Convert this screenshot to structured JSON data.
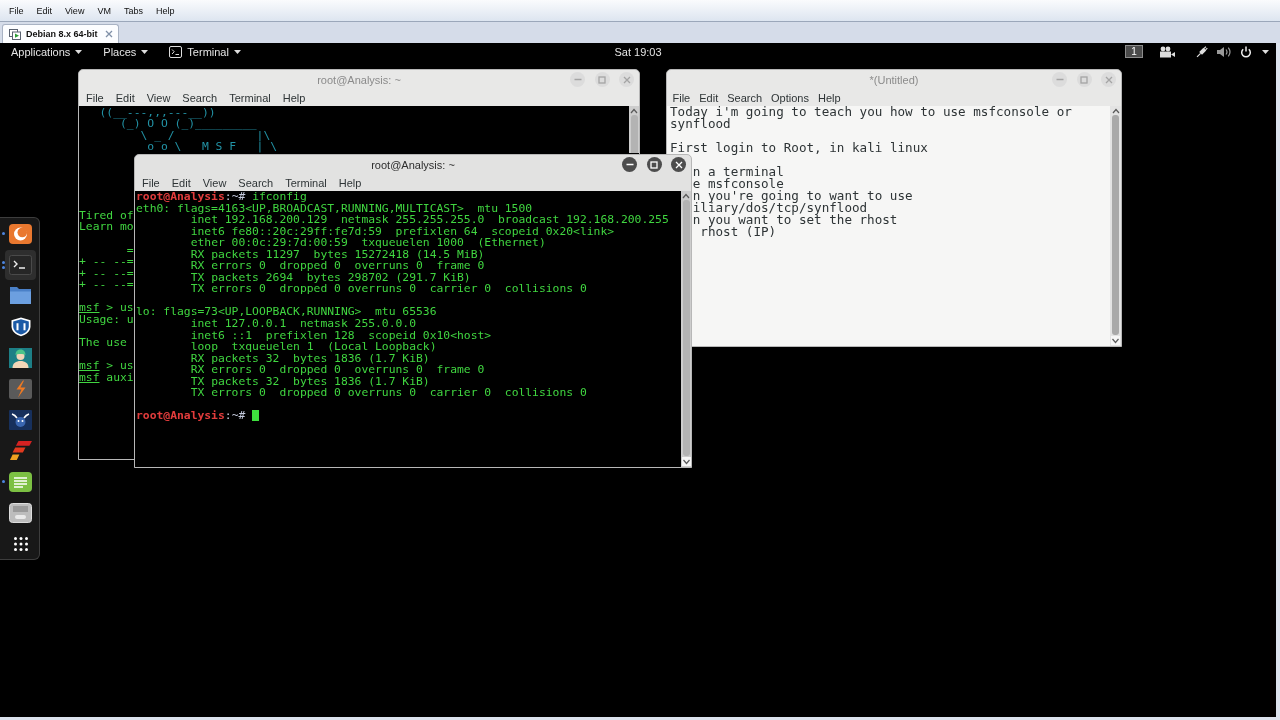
{
  "menu_bar": {
    "items": [
      "File",
      "Edit",
      "View",
      "VM",
      "Tabs",
      "Help"
    ]
  },
  "tabs": [
    {
      "label": "Debian 8.x 64-bit",
      "selected": true
    }
  ],
  "top_bar": {
    "menus": [
      {
        "label": "Applications",
        "kind": "menu"
      },
      {
        "label": "Places",
        "kind": "menu"
      },
      {
        "label": "Terminal",
        "kind": "app-menu"
      }
    ],
    "clock": "Sat 19:03",
    "workspace": "1"
  },
  "dock": [
    {
      "kind": "browser",
      "selected": false,
      "running": true,
      "multiple_windows": false
    },
    {
      "kind": "terminal",
      "selected": true,
      "running": true,
      "multiple_windows": true
    },
    {
      "kind": "files",
      "selected": false,
      "running": false,
      "multiple_windows": false
    },
    {
      "kind": "shield",
      "selected": false,
      "running": false,
      "multiple_windows": false
    },
    {
      "kind": "avatar",
      "selected": false,
      "running": false,
      "multiple_windows": false
    },
    {
      "kind": "lightning",
      "selected": false,
      "running": false,
      "multiple_windows": false
    },
    {
      "kind": "horned-head",
      "selected": false,
      "running": false,
      "multiple_windows": false
    },
    {
      "kind": "slanted-bars",
      "selected": false,
      "running": false,
      "multiple_windows": false
    },
    {
      "kind": "notepad",
      "selected": false,
      "running": true,
      "multiple_windows": false
    },
    {
      "kind": "keypad",
      "selected": false,
      "running": false,
      "multiple_windows": false
    },
    {
      "kind": "app-grid",
      "selected": false,
      "running": false,
      "multiple_windows": false
    }
  ],
  "windows": [
    {
      "kind": "terminal",
      "title": "root@Analysis: ~",
      "active": false,
      "menu": [
        "File",
        "Edit",
        "View",
        "Search",
        "Terminal",
        "Help"
      ],
      "banner": [
        "   ((__---,,,---__))",
        "      (_) O O (_)_________",
        "         \\ _ /            |\\",
        "          o o \\   M S F   | \\"
      ],
      "blocks": [
        {
          "lines": [
            {
              "kind": "output",
              "text": "Tired of"
            },
            {
              "kind": "output",
              "text": "Learn mo"
            }
          ]
        },
        {
          "lines": [
            {
              "kind": "output",
              "text": "       ="
            },
            {
              "kind": "output",
              "text": "+ -- --="
            },
            {
              "kind": "output",
              "text": "+ -- --="
            },
            {
              "kind": "output",
              "text": "+ -- --="
            }
          ]
        },
        {
          "lines": [
            {
              "kind": "msf",
              "prompt": "msf",
              "text": " > us"
            },
            {
              "kind": "output",
              "text": "Usage: u"
            }
          ]
        },
        {
          "lines": [
            {
              "kind": "output",
              "text": "The use"
            }
          ]
        },
        {
          "lines": [
            {
              "kind": "msf",
              "prompt": "msf",
              "text": " > us"
            },
            {
              "kind": "msf",
              "prompt": "msf",
              "text": " auxi"
            }
          ]
        }
      ]
    },
    {
      "kind": "editor",
      "title": "*(Untitled)",
      "active": false,
      "menu": [
        "File",
        "Edit",
        "Search",
        "Options",
        "Help"
      ],
      "paragraphs": [
        {
          "covered": false,
          "lines": [
            "Today i'm going to teach you how to use msfconsole or synflood"
          ]
        },
        {
          "covered": false,
          "lines": [
            "First login to Root, in kali linux"
          ]
        },
        {
          "covered": true,
          "lines": [
            "n a terminal",
            "e msfconsole",
            "n you're going to want to use",
            "iliary/dos/tcp/synflood",
            "n you want to set the rhost",
            " rhost (IP)"
          ]
        }
      ]
    },
    {
      "kind": "terminal",
      "title": "root@Analysis: ~",
      "active": true,
      "menu": [
        "File",
        "Edit",
        "View",
        "Search",
        "Terminal",
        "Help"
      ],
      "blocks": [
        {
          "lines": [
            {
              "kind": "prompt",
              "user": "root@Analysis",
              "path": ":~#",
              "command": "ifconfig"
            },
            {
              "kind": "output",
              "text": "eth0: flags=4163<UP,BROADCAST,RUNNING,MULTICAST>  mtu 1500"
            },
            {
              "kind": "output",
              "text": "        inet 192.168.200.129  netmask 255.255.255.0  broadcast 192.168.200.255"
            },
            {
              "kind": "output",
              "text": "        inet6 fe80::20c:29ff:fe7d:59  prefixlen 64  scopeid 0x20<link>"
            },
            {
              "kind": "output",
              "text": "        ether 00:0c:29:7d:00:59  txqueuelen 1000  (Ethernet)"
            },
            {
              "kind": "output",
              "text": "        RX packets 11297  bytes 15272418 (14.5 MiB)"
            },
            {
              "kind": "output",
              "text": "        RX errors 0  dropped 0  overruns 0  frame 0"
            },
            {
              "kind": "output",
              "text": "        TX packets 2694  bytes 298702 (291.7 KiB)"
            },
            {
              "kind": "output",
              "text": "        TX errors 0  dropped 0 overruns 0  carrier 0  collisions 0"
            }
          ]
        },
        {
          "lines": [
            {
              "kind": "output",
              "text": "lo: flags=73<UP,LOOPBACK,RUNNING>  mtu 65536"
            },
            {
              "kind": "output",
              "text": "        inet 127.0.0.1  netmask 255.0.0.0"
            },
            {
              "kind": "output",
              "text": "        inet6 ::1  prefixlen 128  scopeid 0x10<host>"
            },
            {
              "kind": "output",
              "text": "        loop  txqueuelen 1  (Local Loopback)"
            },
            {
              "kind": "output",
              "text": "        RX packets 32  bytes 1836 (1.7 KiB)"
            },
            {
              "kind": "output",
              "text": "        RX errors 0  dropped 0  overruns 0  frame 0"
            },
            {
              "kind": "output",
              "text": "        TX packets 32  bytes 1836 (1.7 KiB)"
            },
            {
              "kind": "output",
              "text": "        TX errors 0  dropped 0 overruns 0  carrier 0  collisions 0"
            }
          ]
        },
        {
          "lines": [
            {
              "kind": "prompt",
              "user": "root@Analysis",
              "path": ":~#",
              "cursor": true
            }
          ]
        }
      ]
    }
  ]
}
